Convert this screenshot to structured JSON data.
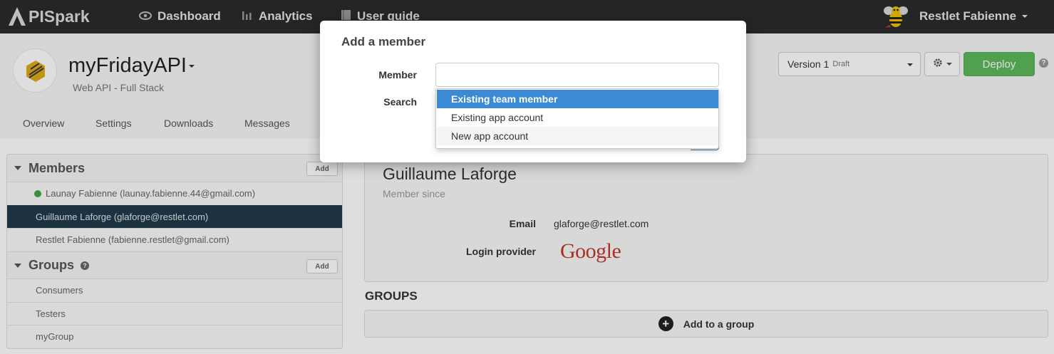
{
  "navbar": {
    "brand": "PISpark",
    "links": [
      {
        "label": "Dashboard",
        "icon": "eye-icon"
      },
      {
        "label": "Analytics",
        "icon": "bar-chart-icon"
      },
      {
        "label": "User guide",
        "icon": "book-icon"
      }
    ],
    "user": "Restlet Fabienne"
  },
  "api": {
    "title": "myFridayAPI",
    "subtitle": "Web API - Full Stack",
    "version_label": "Version 1",
    "version_status": "Draft",
    "deploy_label": "Deploy"
  },
  "tabs": [
    "Overview",
    "Settings",
    "Downloads",
    "Messages"
  ],
  "sidebar": {
    "members_title": "Members",
    "members_add": "Add",
    "members": [
      {
        "label": "Launay Fabienne (launay.fabienne.44@gmail.com)",
        "online": true
      },
      {
        "label": "Guillaume Laforge (glaforge@restlet.com)",
        "active": true
      },
      {
        "label": "Restlet Fabienne (fabienne.restlet@gmail.com)"
      }
    ],
    "groups_title": "Groups",
    "groups_add": "Add",
    "groups": [
      "Consumers",
      "Testers",
      "myGroup"
    ]
  },
  "detail": {
    "name": "Guillaume Laforge",
    "member_since": "Member since",
    "email_label": "Email",
    "email_value": "glaforge@restlet.com",
    "provider_label": "Login provider",
    "provider_value": "Google",
    "groups_title": "GROUPS",
    "add_to_group": "Add to a group"
  },
  "modal": {
    "title": "Add a member",
    "member_label": "Member",
    "member_value": "",
    "search_label": "Search",
    "dropdown_options": [
      {
        "label": "Existing team member",
        "selected": true
      },
      {
        "label": "Existing app account"
      },
      {
        "label": "New app account"
      }
    ]
  },
  "colors": {
    "navbar_bg": "#2b2b2b",
    "accent_selected": "#3b8ad4",
    "deploy_green": "#5cb85c",
    "active_row": "#213a4a",
    "online_dot": "#43a63f",
    "google_red": "#c0392b"
  }
}
